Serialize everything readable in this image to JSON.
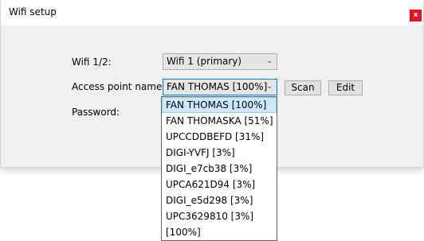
{
  "window": {
    "title": "Wifi setup",
    "close_label": "x"
  },
  "form": {
    "wifi_label": "Wifi 1/2:",
    "wifi_value": "Wifi 1 (primary)",
    "ap_label": "Access point name:",
    "ap_value": "FAN THOMAS [100%]",
    "password_label": "Password:",
    "scan_label": "Scan",
    "edit_label": "Edit"
  },
  "dropdown": {
    "items": [
      "FAN THOMAS [100%]",
      "FAN THOMASKA [51%]",
      "UPCCDDBEFD [31%]",
      "DIGI-YVFJ [3%]",
      "DIGI_e7cb38 [3%]",
      "UPCA621D94 [3%]",
      "DIGI_e5d298 [3%]",
      "UPC3629810 [3%]",
      " [100%]"
    ],
    "selected_index": 0
  },
  "icons": {
    "close": "close-icon",
    "dropdown_arrow": "chevron-down-icon"
  },
  "colors": {
    "close_bg": "#e81123",
    "selected_bg": "#cce8ff",
    "dialog_bg": "#f0f0f0"
  }
}
